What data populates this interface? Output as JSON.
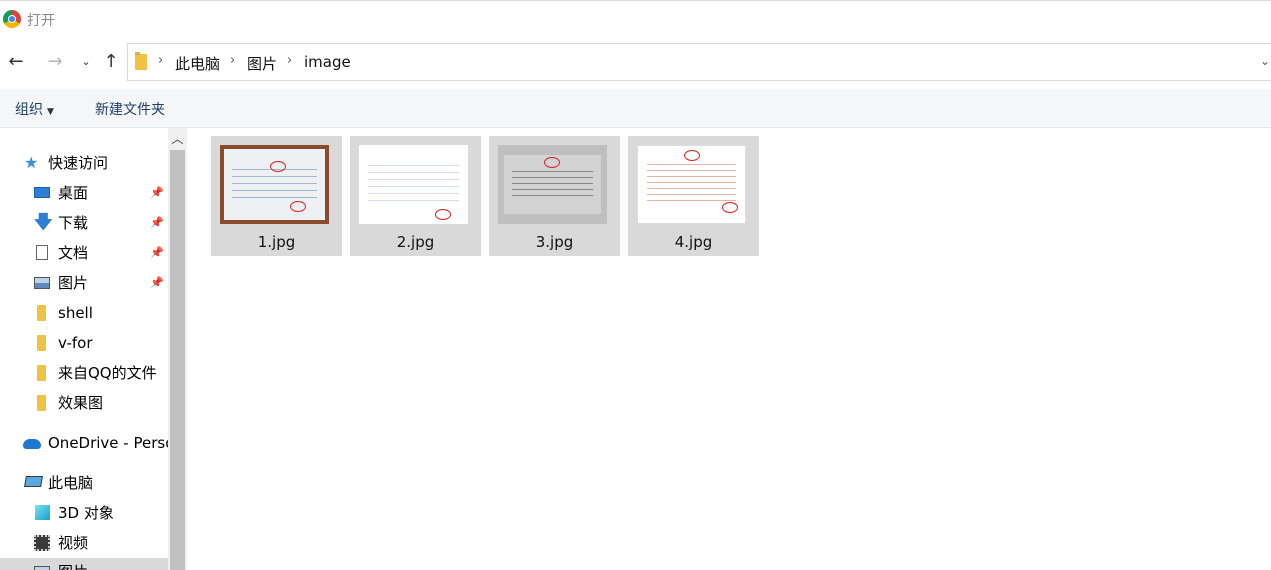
{
  "window": {
    "title": "打开"
  },
  "nav": {
    "back_icon": "arrow-left-icon",
    "forward_icon": "arrow-right-icon",
    "recent_icon": "chevron-down-icon",
    "up_icon": "arrow-up-icon"
  },
  "address": {
    "breadcrumbs": [
      "此电脑",
      "图片",
      "image"
    ]
  },
  "toolbar": {
    "organize_label": "组织",
    "new_folder_label": "新建文件夹"
  },
  "sidebar": {
    "items": [
      {
        "label": "快速访问",
        "icon": "star-icon",
        "pinned": false
      },
      {
        "label": "桌面",
        "icon": "desktop-icon",
        "pinned": true
      },
      {
        "label": "下载",
        "icon": "download-icon",
        "pinned": true
      },
      {
        "label": "文档",
        "icon": "document-icon",
        "pinned": true
      },
      {
        "label": "图片",
        "icon": "pictures-icon",
        "pinned": true
      },
      {
        "label": "shell",
        "icon": "folder-icon",
        "pinned": false
      },
      {
        "label": "v-for",
        "icon": "folder-icon",
        "pinned": false
      },
      {
        "label": "来自QQ的文件",
        "icon": "folder-icon",
        "pinned": false
      },
      {
        "label": "效果图",
        "icon": "folder-icon",
        "pinned": false
      },
      {
        "label": "OneDrive - Perso",
        "icon": "cloud-icon",
        "pinned": false
      },
      {
        "label": "此电脑",
        "icon": "computer-icon",
        "pinned": false
      },
      {
        "label": "3D 对象",
        "icon": "cube-3d-icon",
        "pinned": false
      },
      {
        "label": "视频",
        "icon": "video-icon",
        "pinned": false
      },
      {
        "label": "图片",
        "icon": "pictures-icon",
        "pinned": false,
        "selected": true
      }
    ]
  },
  "files": [
    {
      "name": "1.jpg",
      "selected": true
    },
    {
      "name": "2.jpg",
      "selected": true
    },
    {
      "name": "3.jpg",
      "selected": true
    },
    {
      "name": "4.jpg",
      "selected": true
    }
  ],
  "colors": {
    "selection": "#d9d9d9",
    "accent": "#1e3f66",
    "folder": "#f0c244"
  }
}
